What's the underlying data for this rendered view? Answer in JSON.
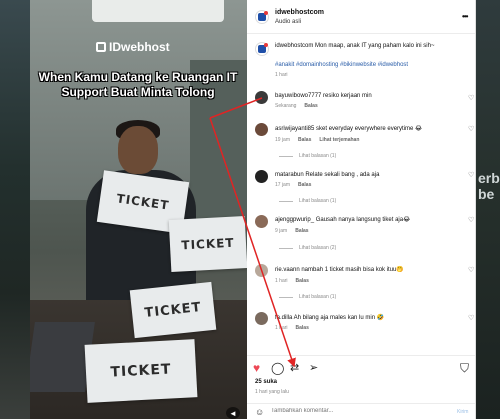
{
  "video": {
    "brand": "IDwebhost",
    "caption": "When Kamu Datang ke Ruangan IT Support Buat Minta Tolong",
    "cards": [
      "TICKET",
      "TICKET",
      "TICKET",
      "TICKET"
    ],
    "mute_icon": "speaker-mute-icon"
  },
  "backdrop": {
    "right_text": "erb\nbe"
  },
  "post": {
    "username": "idwebhostcom",
    "audio": "Audio asli",
    "more_icon": "more-horizontal-icon",
    "caption": "idwebhostcom Mon maap, anak IT yang paham kalo ini sih~",
    "hashtags": "#anakit #domainhosting #bikinwebsite #idwebhost",
    "caption_time": "1 hari"
  },
  "comments": [
    {
      "text": "bayuwibowo7777 resiko kerjaan min",
      "time": "Sekarang",
      "reply": "Balas",
      "translate": "",
      "replies": "",
      "avatar_color": "#3a3a3a"
    },
    {
      "text": "asriwijayanti85 sket everyday everywhere everytime 😂",
      "time": "19 jam",
      "reply": "Balas",
      "translate": "Lihat terjemahan",
      "replies": "Lihat balasan (1)",
      "avatar_color": "#6b4a3a"
    },
    {
      "text": "matarabun Relate sekali bang , ada aja",
      "time": "17 jam",
      "reply": "Balas",
      "translate": "",
      "replies": "Lihat balasan (1)",
      "avatar_color": "#222222"
    },
    {
      "text": "ajenggpwurip_ Gausah nanya langsung tiket aja😂",
      "time": "9 jam",
      "reply": "Balas",
      "translate": "",
      "replies": "Lihat balasan (2)",
      "avatar_color": "#8a6a58"
    },
    {
      "text": "rie.vaann nambah 1 ticket masih bisa kok ituu🤭",
      "time": "1 hari",
      "reply": "Balas",
      "translate": "",
      "replies": "Lihat balasan (1)",
      "avatar_color": "#b8a89a"
    },
    {
      "text": "fa.dilla Ah bilang aja males kan lu min 🤣",
      "time": "1 hari",
      "reply": "Balas",
      "translate": "",
      "replies": "",
      "avatar_color": "#7a6a5e"
    }
  ],
  "actions": {
    "like_icon": "heart-filled-icon",
    "comment_icon": "comment-icon",
    "share_icon": "repost-icon",
    "send_icon": "send-icon",
    "save_icon": "bookmark-icon",
    "like_color": "#ed4956"
  },
  "likes": "25 suka",
  "posted": "1 hari yang lalu",
  "add_comment": {
    "emoji_icon": "emoji-icon",
    "placeholder": "Tambahkan komentar...",
    "send": "Kirim"
  },
  "annotation_color": "#e02424"
}
